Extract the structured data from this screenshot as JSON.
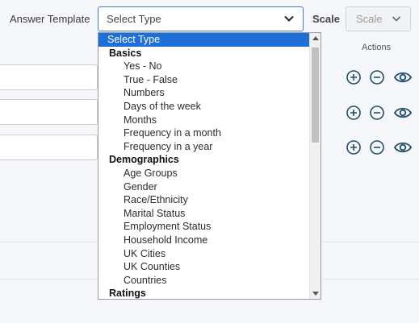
{
  "header": {
    "answer_template_label": "Answer Template",
    "type_select_value": "Select Type",
    "scale_label": "Scale",
    "scale_select_value": "Scale"
  },
  "table": {
    "actions_header": "Actions"
  },
  "dropdown": {
    "options": [
      {
        "kind": "selected",
        "label": "Select Type"
      },
      {
        "kind": "group",
        "label": "Basics"
      },
      {
        "kind": "item",
        "label": "Yes - No"
      },
      {
        "kind": "item",
        "label": "True - False"
      },
      {
        "kind": "item",
        "label": "Numbers"
      },
      {
        "kind": "item",
        "label": "Days of the week"
      },
      {
        "kind": "item",
        "label": "Months"
      },
      {
        "kind": "item",
        "label": "Frequency in a month"
      },
      {
        "kind": "item",
        "label": "Frequency in a year"
      },
      {
        "kind": "group",
        "label": "Demographics"
      },
      {
        "kind": "item",
        "label": "Age Groups"
      },
      {
        "kind": "item",
        "label": "Gender"
      },
      {
        "kind": "item",
        "label": "Race/Ethnicity"
      },
      {
        "kind": "item",
        "label": "Marital Status"
      },
      {
        "kind": "item",
        "label": "Employment Status"
      },
      {
        "kind": "item",
        "label": "Household Income"
      },
      {
        "kind": "item",
        "label": "UK Cities"
      },
      {
        "kind": "item",
        "label": "UK Counties"
      },
      {
        "kind": "item",
        "label": "Countries"
      },
      {
        "kind": "group",
        "label": "Ratings"
      }
    ]
  },
  "icons": {
    "add": "plus-circle-icon",
    "remove": "minus-circle-icon",
    "preview": "eye-icon",
    "chevron": "chevron-down-icon"
  },
  "colors": {
    "accent": "#1f6fd9",
    "icon": "#1f4e66",
    "focus_border": "#3f7ccc"
  }
}
